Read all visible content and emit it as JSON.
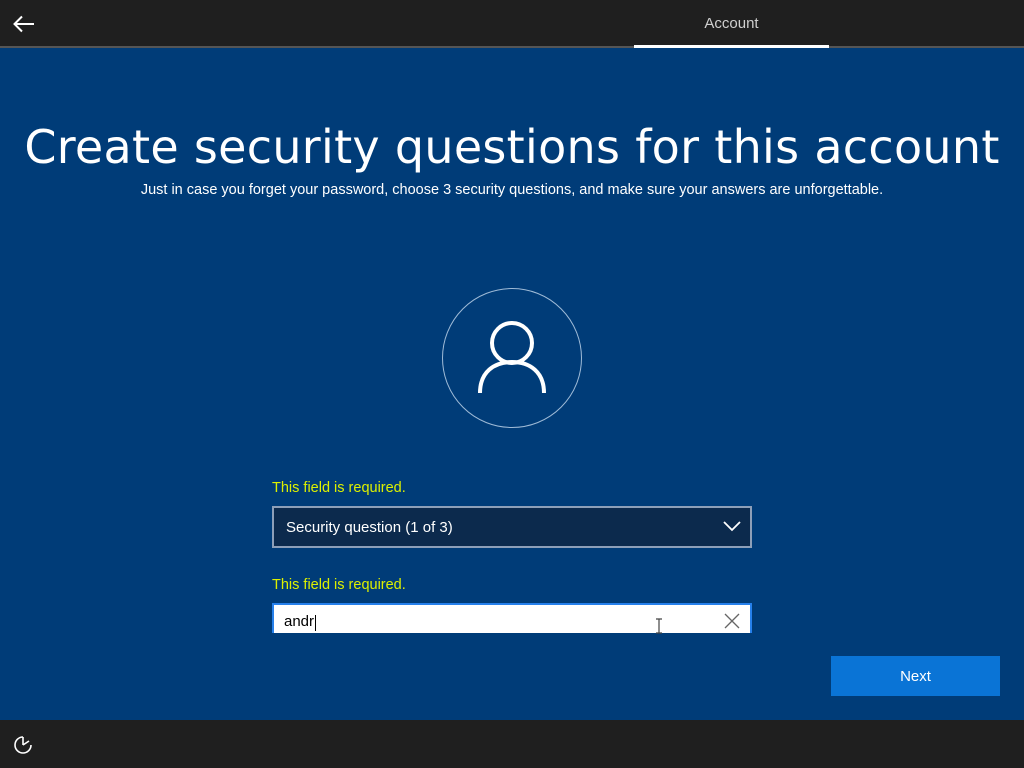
{
  "header": {
    "back_icon": "back-arrow-icon",
    "tab_label": "Account"
  },
  "main": {
    "title": "Create security questions for this account",
    "subtitle": "Just in case you forget your password, choose 3 security questions, and make sure your answers are unforgettable.",
    "avatar_icon": "user-icon"
  },
  "form": {
    "question_error": "This field is required.",
    "question_select_value": "Security question (1 of 3)",
    "answer_error": "This field is required.",
    "answer_value": "andr",
    "clear_icon": "close-icon"
  },
  "footer": {
    "next_label": "Next",
    "accessibility_icon": "ease-of-access-icon"
  },
  "colors": {
    "background": "#003c78",
    "error": "#dcf000",
    "accent": "#0a74d6"
  }
}
